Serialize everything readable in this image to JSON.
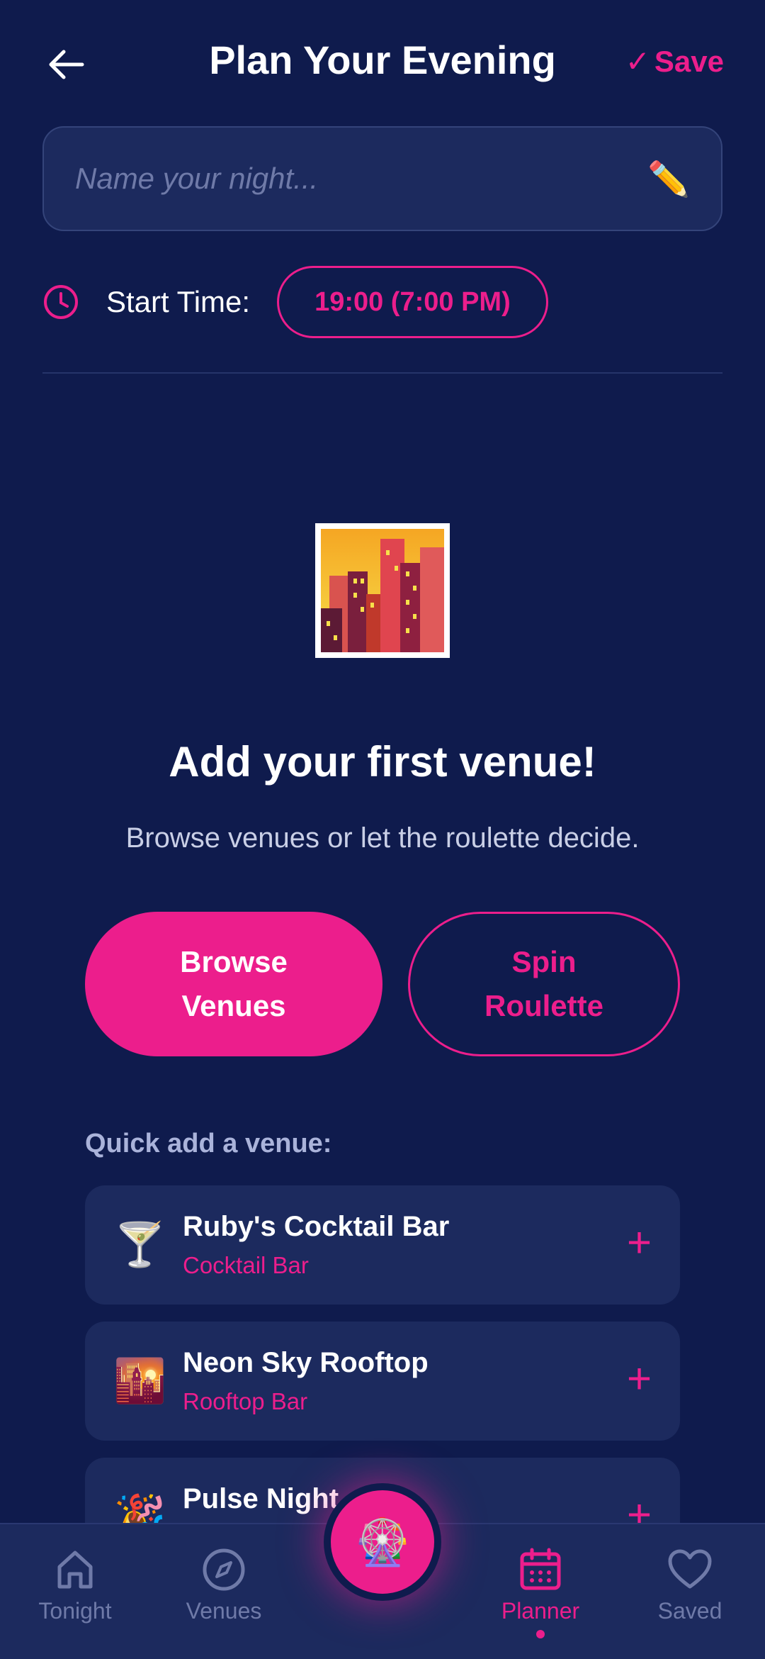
{
  "header": {
    "title": "Plan Your Evening",
    "save_label": "Save",
    "save_check": "✓"
  },
  "name_input": {
    "placeholder": "Name your night...",
    "value": "",
    "icon": "✏️"
  },
  "start_time": {
    "label": "Start Time:",
    "value": "19:00 (7:00 PM)"
  },
  "empty_state": {
    "emoji": "🌆",
    "title": "Add your first venue!",
    "subtitle": "Browse venues or let the roulette decide.",
    "browse_label": "Browse Venues",
    "spin_label": "Spin Roulette"
  },
  "quick_add": {
    "label": "Quick add a venue:",
    "venues": [
      {
        "emoji": "🍸",
        "name": "Ruby's Cocktail Bar",
        "type": "Cocktail Bar",
        "add": "+"
      },
      {
        "emoji": "🌇",
        "name": "Neon Sky Rooftop",
        "type": "Rooftop Bar",
        "add": "+"
      },
      {
        "emoji": "🎉",
        "name": "Pulse Night",
        "type": "",
        "add": "+"
      }
    ]
  },
  "bottom_nav": {
    "items": [
      {
        "label": "Tonight",
        "icon": "home-icon",
        "active": false
      },
      {
        "label": "Venues",
        "icon": "compass-icon",
        "active": false
      },
      {
        "label": "Planner",
        "icon": "calendar-icon",
        "active": true
      },
      {
        "label": "Saved",
        "icon": "heart-icon",
        "active": false
      }
    ],
    "fab_emoji": "🎡"
  },
  "colors": {
    "background": "#0f1b4d",
    "card": "#1c2a5e",
    "accent": "#ec1e8c",
    "muted": "#6f7aa8"
  }
}
